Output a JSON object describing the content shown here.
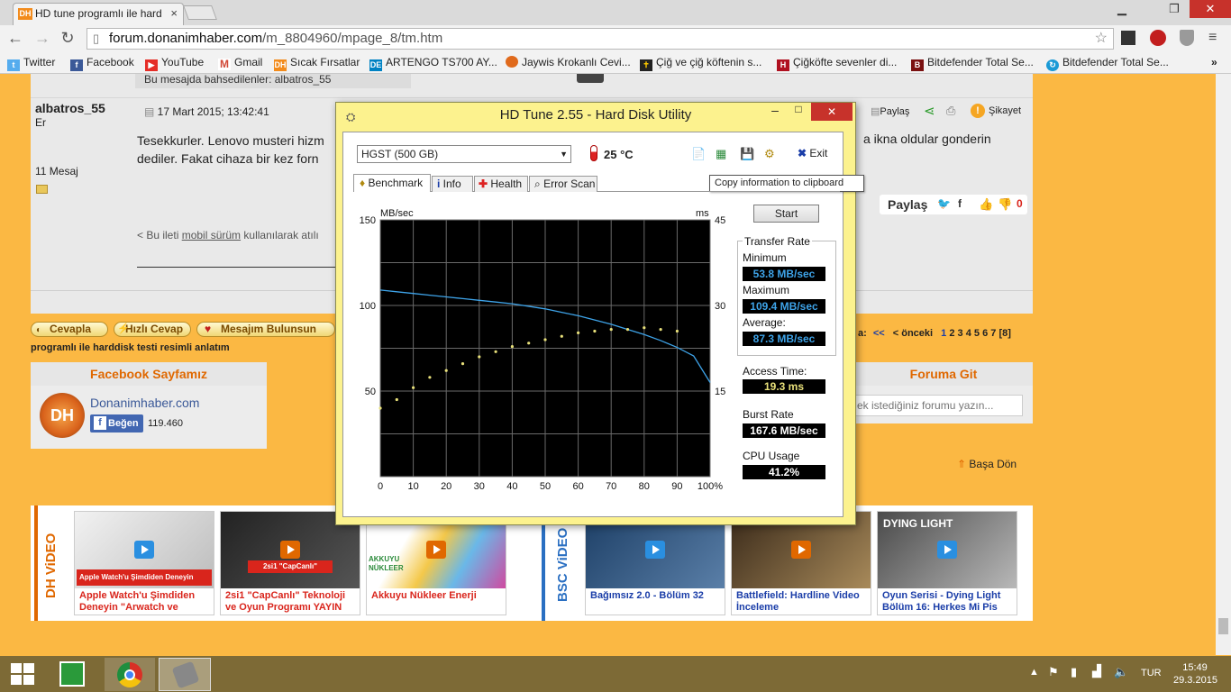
{
  "browser": {
    "tab_title": "HD tune programlı ile hard",
    "tab_favicon": "DH",
    "url_domain": "forum.donanimhaber.com",
    "url_path": "/m_8804960/mpage_8/tm.htm"
  },
  "bookmarks": [
    {
      "label": "Twitter",
      "icon": "twitter-icon",
      "color": "#55acee"
    },
    {
      "label": "Facebook",
      "icon": "facebook-icon",
      "color": "#3b5998"
    },
    {
      "label": "YouTube",
      "icon": "youtube-icon",
      "color": "#e52d27"
    },
    {
      "label": "Gmail",
      "icon": "gmail-icon",
      "color": "#d14836"
    },
    {
      "label": "Sıcak Fırsatlar",
      "icon": "dh-icon",
      "color": "#f28b1c"
    },
    {
      "label": "ARTENGO TS700 AY...",
      "icon": "decathlon-icon",
      "color": "#0082c3"
    },
    {
      "label": "Jaywis Krokanlı Cevi...",
      "icon": "jaywis-icon",
      "color": "#e06a1c"
    },
    {
      "label": "Çiğ ve çiğ köftenin s...",
      "icon": "cross-icon",
      "color": "#222222"
    },
    {
      "label": "Çiğköfte sevenler di...",
      "icon": "h-icon",
      "color": "#b01020"
    },
    {
      "label": "Bitdefender Total Se...",
      "icon": "bitdefender-icon",
      "color": "#7a1010"
    },
    {
      "label": "Bitdefender Total Se...",
      "icon": "refresh-blue-icon",
      "color": "#1a9ad6"
    }
  ],
  "post": {
    "quote_band": "Bu mesajda bahsedilenler: albatros_55",
    "author": "albatros_55",
    "rank": "Er",
    "message_count": "11 Mesaj",
    "date": "17 Mart 2015; 13:42:41",
    "text_line1": "Tesekkurler. Lenovo musteri hizm",
    "text_line2": "dediler. Fakat cihaza bir kez forn",
    "text_right": "a ikna oldular gonderin",
    "mobile_note_pre": "< Bu ileti ",
    "mobile_note_link": "mobil sürüm",
    "mobile_note_post": " kullanılarak atılı",
    "share": "Paylaş",
    "complaint": "Şikayet",
    "share_big": "Paylaş",
    "vote_count": "0"
  },
  "actions": {
    "reply": "Cevapla",
    "quick_reply": "Hızlı Cevap",
    "liked": "Mesajım Bulunsun",
    "thread_title": "programlı ile harddisk testi resimli anlatım",
    "pager_label": "a:",
    "pager_first": "<<",
    "pager_prev": "< önceki",
    "pages": [
      "1",
      "2",
      "3",
      "4",
      "5",
      "6",
      "7",
      "[8]"
    ]
  },
  "facebook": {
    "heading": "Facebook Sayfamız",
    "page_name": "Donanimhaber.com",
    "like_label": "Beğen",
    "like_count": "119.460"
  },
  "forum_go": {
    "heading": "Foruma Git",
    "placeholder": "ek istediğiniz forumu yazın..."
  },
  "back_to_top": "Başa Dön",
  "videos": {
    "dh_label": "DH ViDEO",
    "bsc_label": "BSC ViDEO",
    "items": [
      {
        "caption": "Apple Watch'u Şimdiden Deneyin \"Arwatch ve",
        "thumb_text": "Apple Watch'u Şimdiden Deneyin"
      },
      {
        "caption": "2si1 \"CapCanlı\" Teknoloji ve Oyun Programı YAYIN",
        "thumb_text": "2si1 \"CapCanlı\""
      },
      {
        "caption": "Akkuyu Nükleer Enerji",
        "thumb_text": "AKKUYU NÜKLEER"
      },
      {
        "caption": "Bağımsız 2.0 - Bölüm 32",
        "thumb_text": ""
      },
      {
        "caption": "Battlefield: Hardline Video İnceleme",
        "thumb_text": ""
      },
      {
        "caption": "Oyun Serisi - Dying Light Bölüm 16: Herkes Mi Pis",
        "thumb_text": "DYING LIGHT"
      }
    ]
  },
  "hdtune": {
    "title": "HD Tune 2.55 - Hard Disk Utility",
    "drive": "HGST (500 GB)",
    "temperature": "25 °C",
    "exit": "Exit",
    "tooltip": "Copy information to clipboard",
    "tabs": [
      "Benchmark",
      "Info",
      "Health",
      "Error Scan"
    ],
    "start": "Start",
    "transfer_rate": "Transfer Rate",
    "minimum_label": "Minimum",
    "minimum": "53.8 MB/sec",
    "maximum_label": "Maximum",
    "maximum": "109.4 MB/sec",
    "average_label": "Average:",
    "average": "87.3 MB/sec",
    "access_label": "Access Time:",
    "access": "19.3 ms",
    "burst_label": "Burst Rate",
    "burst": "167.6 MB/sec",
    "cpu_label": "CPU Usage",
    "cpu": "41.2%"
  },
  "chart_data": {
    "type": "line",
    "xlabel": "",
    "ylabel": "MB/sec",
    "y2label": "ms",
    "x_ticks": [
      "0",
      "10",
      "20",
      "30",
      "40",
      "50",
      "60",
      "70",
      "80",
      "90",
      "100%"
    ],
    "y_ticks": [
      "150",
      "100",
      "50"
    ],
    "y2_ticks": [
      "45",
      "30",
      "15"
    ],
    "xlim": [
      0,
      100
    ],
    "ylim": [
      0,
      150
    ],
    "y2lim": [
      0,
      45
    ],
    "grid": true,
    "series": [
      {
        "name": "",
        "color": "#3ea3e8",
        "x": [
          0,
          5,
          10,
          15,
          20,
          25,
          30,
          35,
          40,
          45,
          50,
          55,
          60,
          65,
          70,
          75,
          80,
          85,
          90,
          95,
          100
        ],
        "values": [
          109,
          108,
          107,
          106,
          105,
          104,
          103,
          102,
          101,
          99.5,
          98,
          96,
          94,
          91.5,
          89,
          86,
          83,
          79.5,
          75.5,
          70.5,
          55
        ]
      },
      {
        "name": "",
        "color": "#e8e07a",
        "style": "scatter",
        "x": [
          0,
          5,
          10,
          15,
          20,
          25,
          30,
          35,
          40,
          45,
          50,
          55,
          60,
          65,
          70,
          75,
          80,
          85,
          90
        ],
        "values": [
          40,
          45,
          52,
          58,
          62,
          66,
          70,
          73,
          76,
          78,
          80,
          82,
          84,
          85,
          86,
          86,
          87,
          86,
          85
        ]
      }
    ]
  },
  "taskbar": {
    "language": "TUR",
    "time": "15:49",
    "date": "29.3.2015"
  }
}
